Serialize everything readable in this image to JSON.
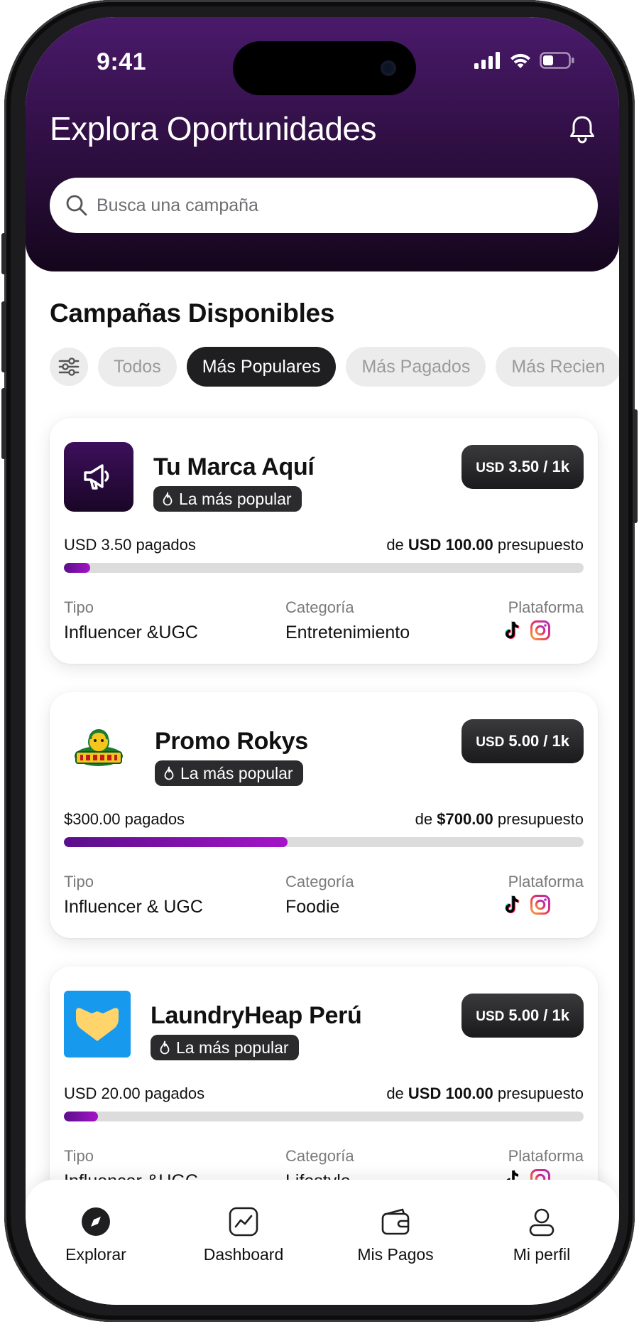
{
  "status_bar": {
    "time": "9:41"
  },
  "header": {
    "title": "Explora Oportunidades"
  },
  "search": {
    "placeholder": "Busca una campaña"
  },
  "section": {
    "title": "Campañas Disponibles"
  },
  "filters": [
    {
      "label": "Todos",
      "active": false
    },
    {
      "label": "Más Populares",
      "active": true
    },
    {
      "label": "Más Pagados",
      "active": false
    },
    {
      "label": "Más Recien",
      "active": false
    }
  ],
  "labels": {
    "type": "Tipo",
    "category": "Categoría",
    "platform": "Plataforma"
  },
  "campaigns": [
    {
      "name": "Tu Marca Aquí",
      "badge": "La más popular",
      "price_currency": "USD",
      "price_amount": "3.50 / 1k",
      "paid": "USD 3.50 pagados",
      "budget_prefix": "de",
      "budget_amount": "USD 100.00",
      "budget_suffix": "presupuesto",
      "progress": 0.035,
      "type": "Influencer &UGC",
      "category": "Entretenimiento",
      "platforms": [
        "tiktok-icon",
        "instagram-icon"
      ]
    },
    {
      "name": "Promo Rokys",
      "badge": "La más popular",
      "price_currency": "USD",
      "price_amount": "5.00 / 1k",
      "paid": "$300.00 pagados",
      "budget_prefix": "de",
      "budget_amount": "$700.00",
      "budget_suffix": "presupuesto",
      "progress": 0.43,
      "type": "Influencer & UGC",
      "category": "Foodie",
      "platforms": [
        "tiktok-icon",
        "instagram-icon"
      ]
    },
    {
      "name": "LaundryHeap Perú",
      "badge": "La más popular",
      "price_currency": "USD",
      "price_amount": "5.00 / 1k",
      "paid": "USD 20.00 pagados",
      "budget_prefix": "de",
      "budget_amount": "USD 100.00",
      "budget_suffix": "presupuesto",
      "progress": 0.065,
      "type": "Influencer &UGC",
      "category": "Lifestyle",
      "platforms": [
        "tiktok-icon",
        "instagram-icon"
      ]
    }
  ],
  "nav": [
    {
      "label": "Explorar",
      "icon": "compass-icon",
      "active": true
    },
    {
      "label": "Dashboard",
      "icon": "chart-icon",
      "active": false
    },
    {
      "label": "Mis Pagos",
      "icon": "wallet-icon",
      "active": false
    },
    {
      "label": "Mi perfil",
      "icon": "user-icon",
      "active": false
    }
  ],
  "colors": {
    "header_gradient_top": "#4a1a6b",
    "header_gradient_bottom": "#14061c",
    "progress_start": "#5a0f8a",
    "progress_end": "#a414c8",
    "chip_active": "#1f1f21",
    "chip_inactive": "#ececec"
  }
}
